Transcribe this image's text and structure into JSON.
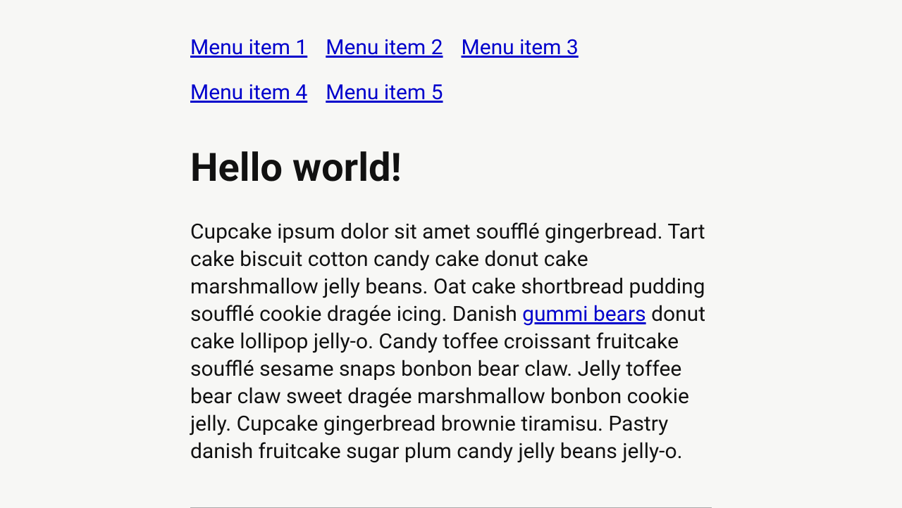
{
  "nav": {
    "items": [
      {
        "label": "Menu item 1"
      },
      {
        "label": "Menu item 2"
      },
      {
        "label": "Menu item 3"
      },
      {
        "label": "Menu item 4"
      },
      {
        "label": "Menu item 5"
      }
    ]
  },
  "main": {
    "heading": "Hello world!",
    "para_pre": "Cupcake ipsum dolor sit amet soufflé gingerbread. Tart cake biscuit cotton candy cake donut cake marshmallow jelly beans. Oat cake shortbread pudding soufflé cookie dragée icing. Danish ",
    "para_link": "gummi bears",
    "para_post": " donut cake lollipop jelly-o. Candy toffee croissant fruitcake soufflé sesame snaps bonbon bear claw. Jelly toffee bear claw sweet dragée marshmallow bonbon cookie jelly. Cupcake gingerbread brownie tiramisu. Pastry danish fruitcake sugar plum candy jelly beans jelly-o."
  }
}
